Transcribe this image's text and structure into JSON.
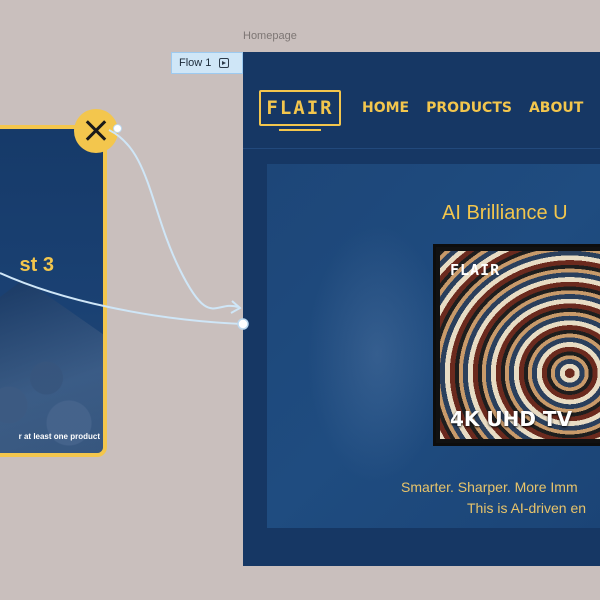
{
  "frame_label": "Homepage",
  "flow_chip": {
    "label": "Flow 1",
    "icon": "play-icon"
  },
  "left_frame": {
    "title": "st 3",
    "note": "r at least one product",
    "accent": "#f3c64d"
  },
  "close_badge": {
    "icon": "close-icon"
  },
  "homepage": {
    "logo": "FLAIR",
    "nav": [
      "HOME",
      "PRODUCTS",
      "ABOUT"
    ],
    "hero_heading": "AI Brilliance U",
    "tv_brand": "FLAIR",
    "tv_label": "4K UHD TV",
    "tagline_1": "Smarter. Sharper. More Imm",
    "tagline_2": "This is AI-driven en",
    "background": "#163764",
    "accent": "#f3c64d"
  }
}
